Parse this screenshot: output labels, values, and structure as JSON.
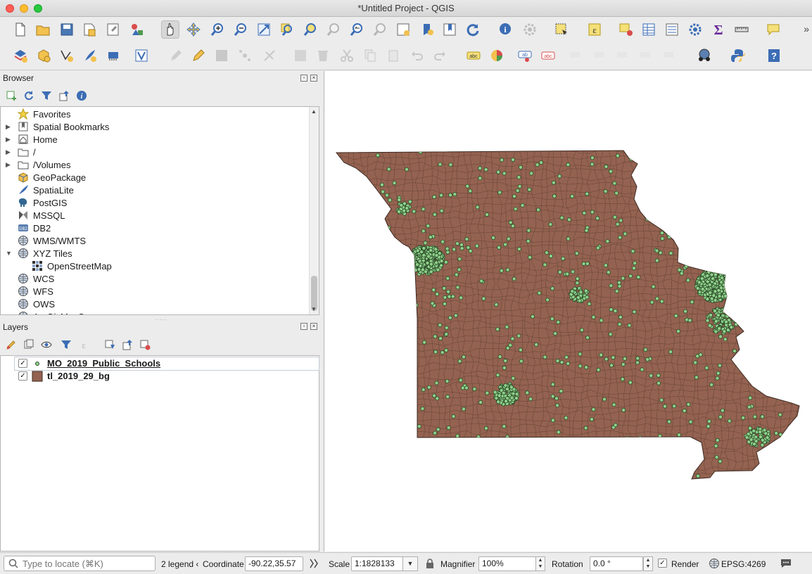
{
  "window": {
    "title": "*Untitled Project - QGIS"
  },
  "browser_panel": {
    "title": "Browser",
    "items": [
      {
        "label": "Favorites",
        "icon": "star-icon",
        "expandable": false
      },
      {
        "label": "Spatial Bookmarks",
        "icon": "bookmark-icon",
        "expandable": true
      },
      {
        "label": "Home",
        "icon": "home-icon",
        "expandable": true
      },
      {
        "label": "/",
        "icon": "folder-icon",
        "expandable": true
      },
      {
        "label": "/Volumes",
        "icon": "folder-icon",
        "expandable": true
      },
      {
        "label": "GeoPackage",
        "icon": "geopackage-icon",
        "expandable": false
      },
      {
        "label": "SpatiaLite",
        "icon": "feather-icon",
        "expandable": false
      },
      {
        "label": "PostGIS",
        "icon": "elephant-icon",
        "expandable": false
      },
      {
        "label": "MSSQL",
        "icon": "mssql-icon",
        "expandable": false
      },
      {
        "label": "DB2",
        "icon": "db2-icon",
        "expandable": false
      },
      {
        "label": "WMS/WMTS",
        "icon": "globe-icon",
        "expandable": false
      },
      {
        "label": "XYZ Tiles",
        "icon": "globe-icon",
        "expandable": true,
        "expanded": true
      },
      {
        "label": "OpenStreetMap",
        "icon": "tiles-icon",
        "child": true
      },
      {
        "label": "WCS",
        "icon": "globe-icon",
        "expandable": false
      },
      {
        "label": "WFS",
        "icon": "globe-icon",
        "expandable": false
      },
      {
        "label": "OWS",
        "icon": "globe-icon",
        "expandable": false
      },
      {
        "label": "ArcGisMapServer",
        "icon": "globe-icon",
        "expandable": false
      }
    ]
  },
  "layers_panel": {
    "title": "Layers",
    "layers": [
      {
        "name": "MO_2019_Public_Schools",
        "checked": true,
        "symbol": "point",
        "selected": true
      },
      {
        "name": "tl_2019_29_bg",
        "checked": true,
        "symbol": "polygon",
        "color": "#946250"
      }
    ]
  },
  "map": {
    "polygon_fill": "#946250",
    "polygon_stroke": "#3d2a22",
    "point_fill": "#8fd18a",
    "point_stroke": "#2b4a29"
  },
  "statusbar": {
    "locate_placeholder": "Type to locate (⌘K)",
    "legend_text": "2 legend ‹",
    "coordinate_label": "Coordinate",
    "coordinate_value": "-90.22,35.57",
    "scale_label": "Scale",
    "scale_value": "1:1828133",
    "magnifier_label": "Magnifier",
    "magnifier_value": "100%",
    "rotation_label": "Rotation",
    "rotation_value": "0.0 °",
    "render_label": "Render",
    "render_checked": true,
    "crs": "EPSG:4269"
  }
}
